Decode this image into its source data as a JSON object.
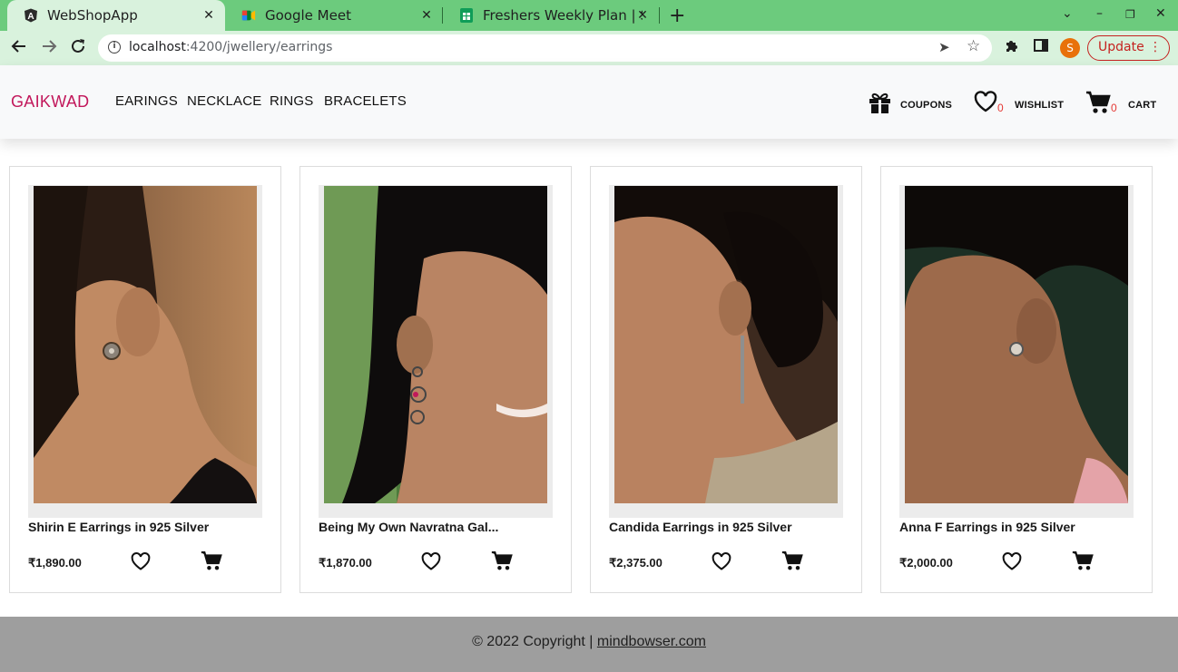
{
  "browser": {
    "tabs": [
      {
        "title": "WebShopApp",
        "active": true
      },
      {
        "title": "Google Meet",
        "active": false
      },
      {
        "title": "Freshers Weekly Plan | Sh",
        "active": false
      }
    ],
    "new_tab": "+",
    "address": {
      "host": "localhost",
      "path": ":4200/jwellery/earrings"
    },
    "profile_initial": "S",
    "update_label": "Update"
  },
  "header": {
    "brand": "GAIKWAD",
    "menu": [
      "EARINGS",
      "NECKLACE",
      "RINGS",
      "BRACELETS"
    ],
    "coupons_label": "COUPONS",
    "wishlist_label": "WISHLIST",
    "wishlist_count": "0",
    "cart_label": "CART",
    "cart_count": "0"
  },
  "products": [
    {
      "name": "Shirin E Earrings in 925 Silver",
      "price": "₹1,890.00"
    },
    {
      "name": "Being My Own Navratna Gal...",
      "price": "₹1,870.00"
    },
    {
      "name": "Candida Earrings in 925 Silver",
      "price": "₹2,375.00"
    },
    {
      "name": "Anna F Earrings in 925 Silver",
      "price": "₹2,000.00"
    }
  ],
  "footer": {
    "copyright": "© 2022 Copyright |",
    "link": "mindbowser.com"
  },
  "colors": {
    "tab_strip": "#6ccb7d",
    "toolbar": "#d9f2dd",
    "brand": "#c2185b",
    "count": "#e53935",
    "footer": "#9e9e9e",
    "update": "#c5221f"
  },
  "icons": {
    "coupons": "gift-icon",
    "wishlist": "heart-icon",
    "cart": "cart-icon"
  }
}
